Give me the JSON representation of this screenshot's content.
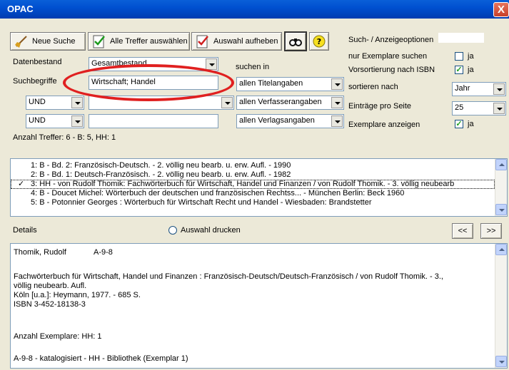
{
  "window": {
    "title": "OPAC",
    "close_glyph": "X"
  },
  "toolbar": {
    "new_search": "Neue Suche",
    "select_all": "Alle Treffer auswählen",
    "clear_selection": "Auswahl aufheben"
  },
  "search": {
    "datenbestand_label": "Datenbestand",
    "datenbestand_value": "Gesamtbestand",
    "suchbegriffe_label": "Suchbegriffe",
    "suchen_in_label": "suchen in",
    "term1": "Wirtschaft; Handel",
    "term2": "",
    "term3": "",
    "op2": "UND",
    "op3": "UND",
    "field1": "allen Titelangaben",
    "field2": "allen Verfasserangaben",
    "field3": "allen Verlagsangaben"
  },
  "options": {
    "title": "Such- / Anzeigeoptionen",
    "only_copies_label": "nur Exemplare suchen",
    "only_copies_ja": "ja",
    "only_copies_checked": false,
    "presort_isbn_label": "Vorsortierung nach ISBN",
    "presort_isbn_ja": "ja",
    "presort_isbn_checked": true,
    "sort_by_label": "sortieren nach",
    "sort_by_value": "Jahr",
    "per_page_label": "Einträge pro Seite",
    "per_page_value": "25",
    "show_copies_label": "Exemplare anzeigen",
    "show_copies_ja": "ja",
    "show_copies_checked": true
  },
  "hits": {
    "summary": "Anzahl Treffer: 6 - B: 5, HH: 1"
  },
  "results": [
    {
      "text": "1: B - Bd. 2: Französisch-Deutsch. - 2. völlig neu bearb. u. erw. Aufl. - 1990",
      "checked": false
    },
    {
      "text": "2: B - Bd. 1: Deutsch-Französisch. - 2. völlig neu bearb. u. erw. Aufl. - 1982",
      "checked": false
    },
    {
      "text": "3: HH - von Rudolf Thomik: Fachwörterbuch für Wirtschaft, Handel und Finanzen / von Rudolf Thomik. - 3. völlig neubearb",
      "checked": true
    },
    {
      "text": "4: B - Doucet Michel: Wörterbuch der deutschen und französischen Rechtss... - München Berlin: Beck 1960",
      "checked": false
    },
    {
      "text": "5: B - Potonnier Georges : Wörterbuch für Wirtschaft Recht und Handel - Wiesbaden: Brandstetter",
      "checked": false
    }
  ],
  "details_bar": {
    "label": "Details",
    "print_selection": "Auswahl drucken",
    "prev": "<<",
    "next": ">>"
  },
  "details": {
    "line1_author": "Thomik, Rudolf",
    "line1_sig": "A-9-8",
    "line2": "Fachwörterbuch für Wirtschaft, Handel und Finanzen : Französisch-Deutsch/Deutsch-Französisch / von Rudolf Thomik. - 3.,",
    "line3": "völlig neubearb. Aufl.",
    "line4": "Köln [u.a.]: Heymann, 1977. - 685 S.",
    "line5": "ISBN 3-452-18138-3",
    "line6": "Anzahl Exemplare:  HH: 1",
    "line7": "A-9-8 - katalogisiert - HH - Bibliothek (Exemplar 1)"
  },
  "colors": {
    "titlebar": "#0050d0",
    "window_bg": "#ece9d8",
    "highlight_ellipse": "#e02020"
  }
}
